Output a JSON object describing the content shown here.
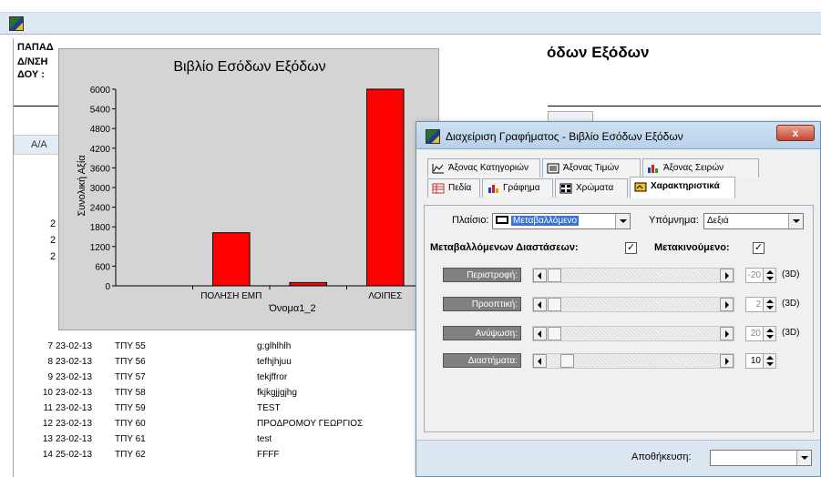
{
  "report": {
    "labels": [
      "ΠΑΠΑΔ",
      "Δ/ΝΣΗ",
      "ΔΟΥ :"
    ],
    "title_fragment": "όδων Εξόδων",
    "column_aa": "Α/Α",
    "left_digits": [
      "2",
      "2",
      "2"
    ],
    "rows": [
      {
        "num": "7",
        "date": "23-02-13",
        "code": "ΤΠΥ 55",
        "desc": "g;glhlhlh"
      },
      {
        "num": "8",
        "date": "23-02-13",
        "code": "ΤΠΥ 56",
        "desc": "tefhjhjuu"
      },
      {
        "num": "9",
        "date": "23-02-13",
        "code": "ΤΠΥ 57",
        "desc": "tekjffror"
      },
      {
        "num": "10",
        "date": "23-02-13",
        "code": "ΤΠΥ 58",
        "desc": "fkjkgjjgjhg"
      },
      {
        "num": "11",
        "date": "23-02-13",
        "code": "ΤΠΥ 59",
        "desc": "TEST"
      },
      {
        "num": "12",
        "date": "23-02-13",
        "code": "ΤΠΥ 60",
        "desc": "ΠΡΟΔΡΟΜΟΥ ΓΕΩΡΓΙΟΣ"
      },
      {
        "num": "13",
        "date": "23-02-13",
        "code": "ΤΠΥ 61",
        "desc": "test"
      },
      {
        "num": "14",
        "date": "25-02-13",
        "code": "ΤΠΥ 62",
        "desc": "FFFF"
      }
    ]
  },
  "chart_data": {
    "type": "bar",
    "title": "Βιβλίο Εσόδων Εξόδων",
    "xlabel": "Όνομα1_2",
    "ylabel": "Συνολική Αξία",
    "categories": [
      "",
      "ΠΟΛΗΣΗ ΕΜΠ",
      "",
      "ΛΟΙΠΕΣ"
    ],
    "values": [
      0,
      1620,
      100,
      6000
    ],
    "ylim": [
      0,
      6000
    ],
    "yticks": [
      "0",
      "600",
      "1200",
      "1800",
      "2400",
      "3000",
      "3600",
      "4200",
      "4800",
      "5400",
      "6000"
    ],
    "bar_color": "#ff0000",
    "grid": false
  },
  "dialog": {
    "title": "Διαχείριση Γραφήματος - Βιβλίο Εσόδων Εξόδων",
    "close_label": "x",
    "tabs_row1": [
      {
        "label": "Άξονας Κατηγοριών",
        "icon": "axis-categories-icon"
      },
      {
        "label": "Άξονας Τιμών",
        "icon": "axis-values-icon"
      },
      {
        "label": "Άξονας Σειρών",
        "icon": "axis-series-icon"
      }
    ],
    "tabs_row2": [
      {
        "label": "Πεδία",
        "icon": "fields-icon"
      },
      {
        "label": "Γράφημα",
        "icon": "chart-icon"
      },
      {
        "label": "Χρώματα",
        "icon": "colors-icon"
      },
      {
        "label": "Χαρακτηριστικά",
        "icon": "features-icon",
        "active": true
      }
    ],
    "frame_label": "Πλαίσιο:",
    "frame_value": "Μεταβαλλόμενο",
    "legend_label": "Υπόμνημα:",
    "legend_value": "Δεξιά",
    "resizable_label": "Μεταβαλλόμενων Διαστάσεων:",
    "resizable_checked": "✓",
    "movable_label": "Μετακινούμενο:",
    "movable_checked": "✓",
    "properties": [
      {
        "label": "Περιστροφή:",
        "value": "-20",
        "unit": "(3D)",
        "enabled": false
      },
      {
        "label": "Προοπτική:",
        "value": "2",
        "unit": "(3D)",
        "enabled": false
      },
      {
        "label": "Ανύψωση:",
        "value": "20",
        "unit": "(3D)",
        "enabled": false
      },
      {
        "label": "Διαστήματα:",
        "value": "10",
        "unit": "",
        "enabled": true
      }
    ],
    "save_label": "Αποθήκευση:",
    "save_value": ""
  },
  "colors": {
    "bar": "#ff0000",
    "chart_bg": "#d4d4d4",
    "dialog_title": "#b9d1ea",
    "close_button": "#c7442e"
  }
}
